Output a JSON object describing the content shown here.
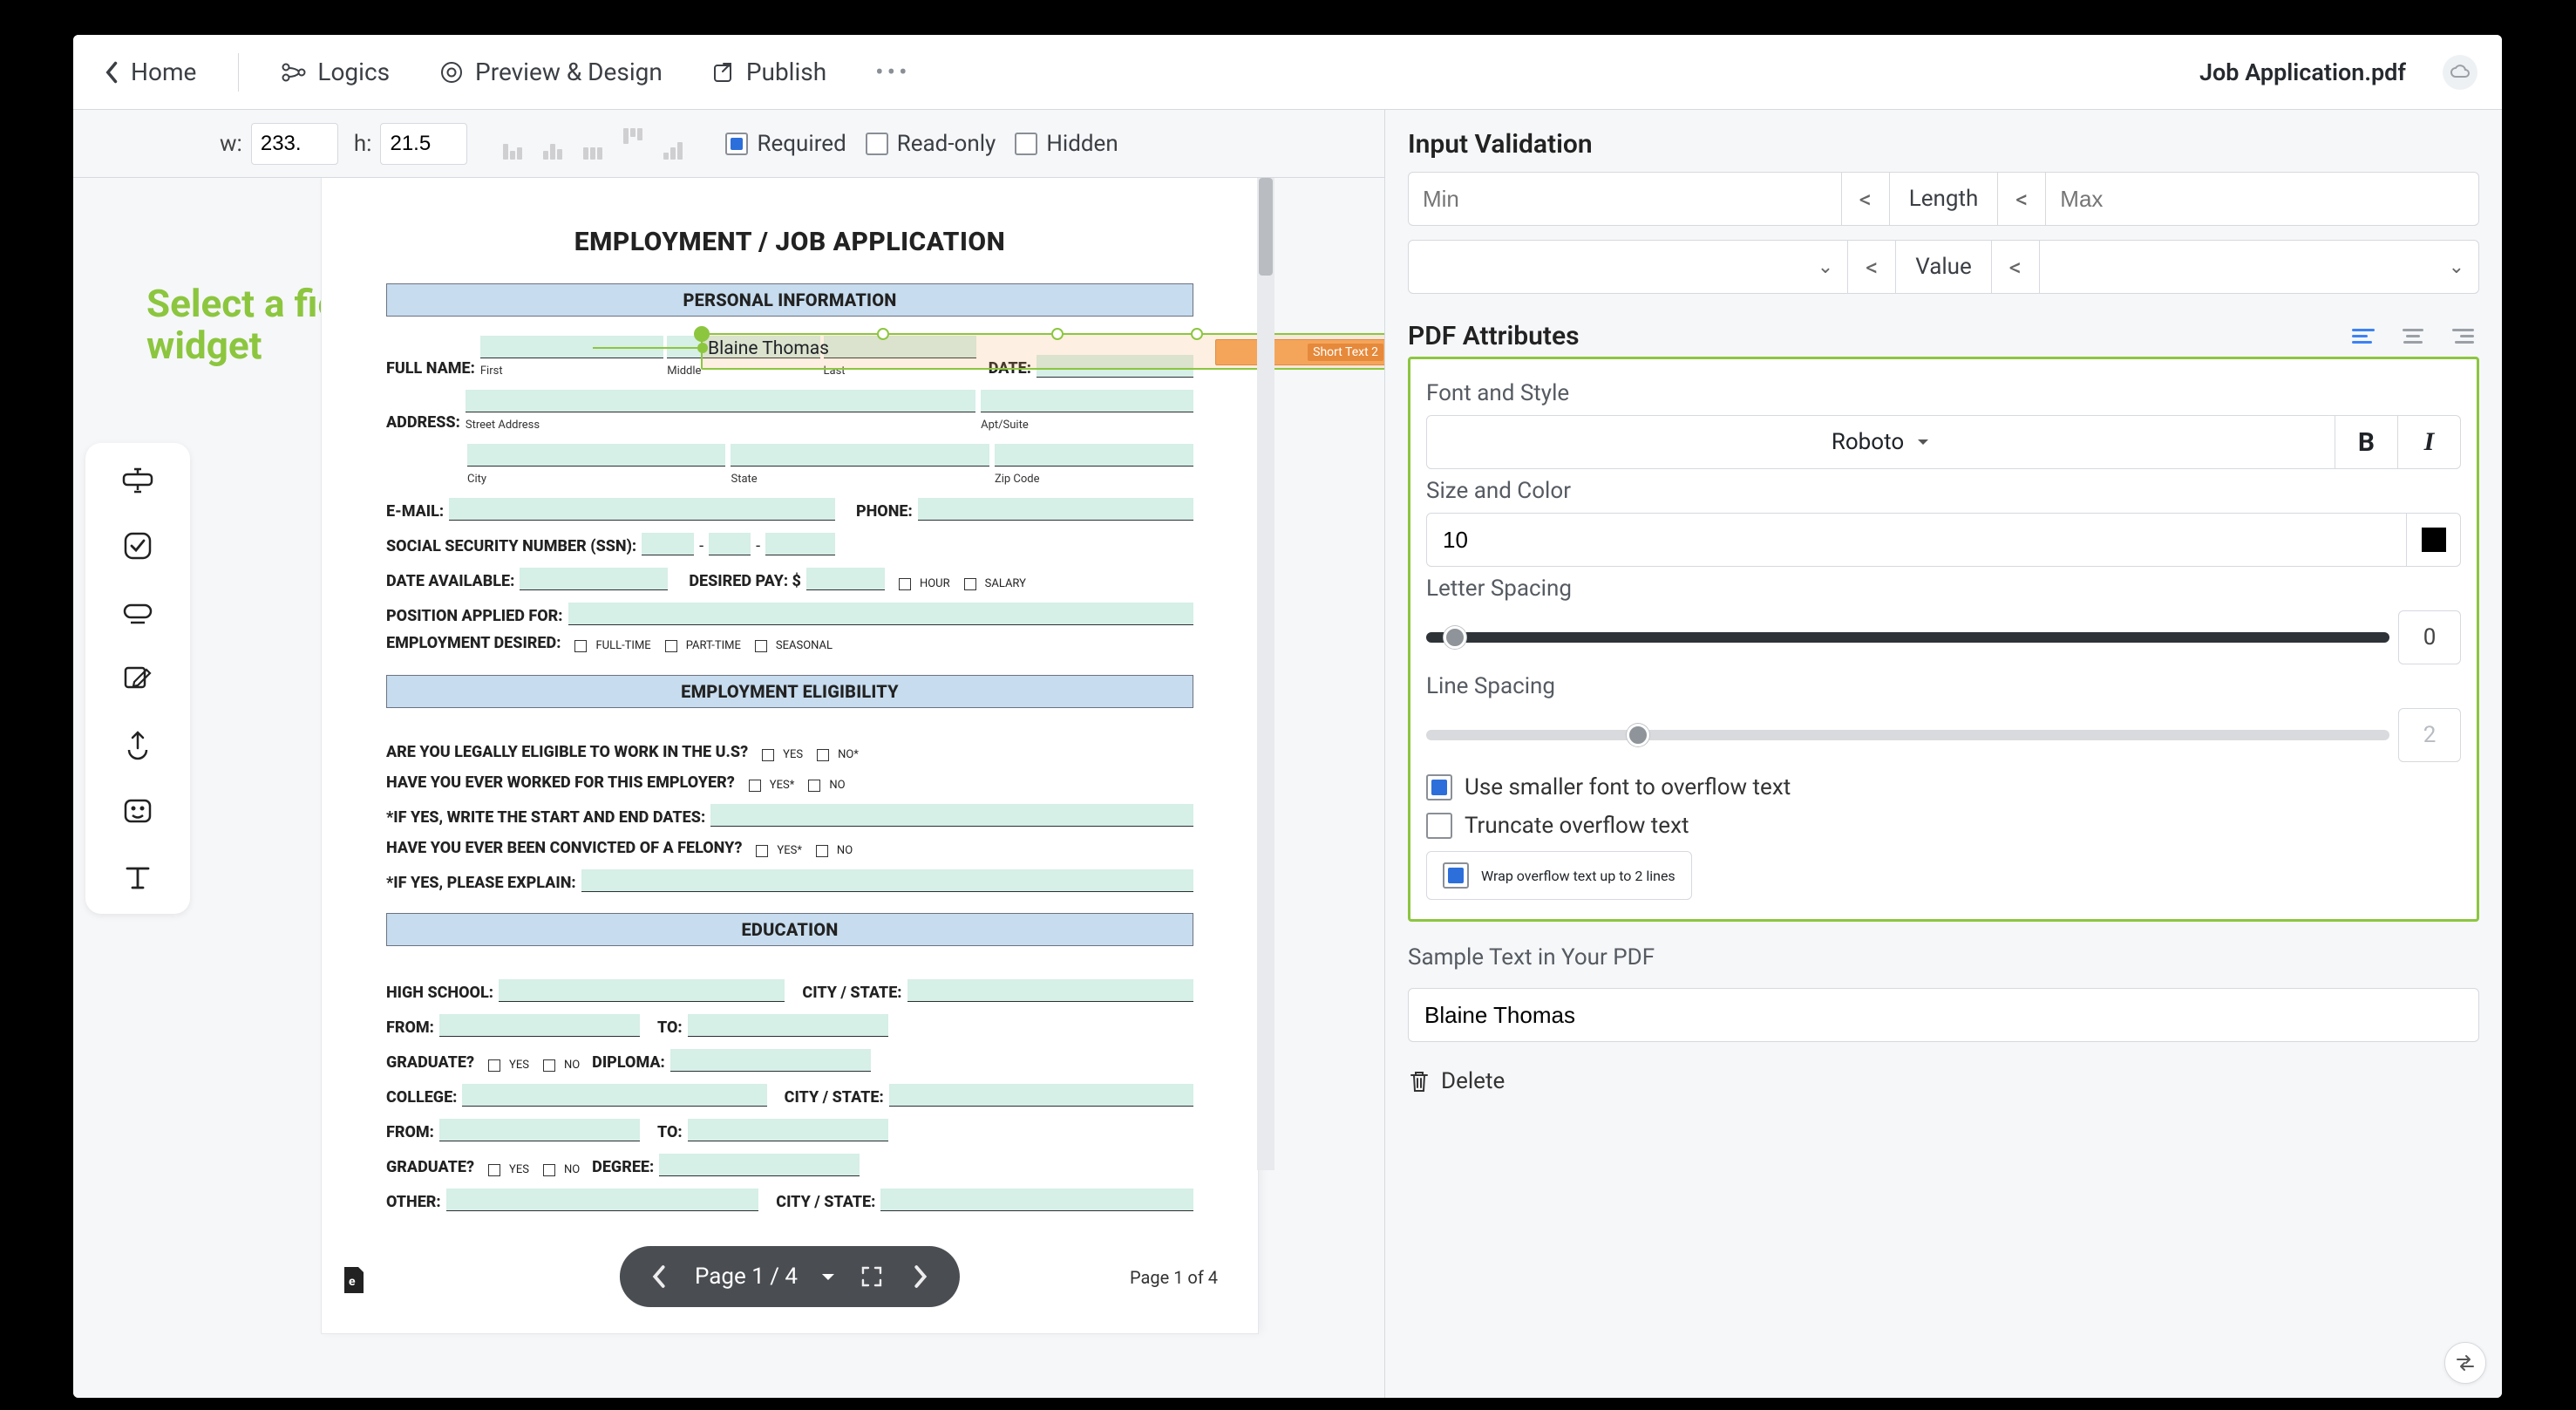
{
  "header": {
    "home": "Home",
    "logics": "Logics",
    "preview": "Preview & Design",
    "publish": "Publish",
    "filename": "Job Application.pdf"
  },
  "props": {
    "w_label": "w:",
    "w_value": "233.",
    "h_label": "h:",
    "h_value": "21.5",
    "required": "Required",
    "readonly": "Read-only",
    "hidden": "Hidden"
  },
  "canvas": {
    "prompt": "Select a field widget",
    "title": "EMPLOYMENT / JOB APPLICATION",
    "s_personal": "PERSONAL INFORMATION",
    "full_name": "FULL NAME:",
    "first": "First",
    "middle": "Middle",
    "last": "Last",
    "date": "DATE:",
    "short_text_tag": "Short Text 2",
    "selected_value": "Blaine Thomas",
    "address": "ADDRESS:",
    "street": "Street Address",
    "apt": "Apt/Suite",
    "city": "City",
    "state": "State",
    "zip": "Zip Code",
    "email": "E-MAIL:",
    "phone": "PHONE:",
    "ssn": "SOCIAL SECURITY NUMBER (SSN):",
    "date_avail": "DATE AVAILABLE:",
    "desired_pay": "DESIRED PAY: $",
    "hour": "HOUR",
    "salary": "SALARY",
    "position": "POSITION APPLIED FOR:",
    "emp_desired": "EMPLOYMENT DESIRED:",
    "full_time": "FULL-TIME",
    "part_time": "PART-TIME",
    "seasonal": "SEASONAL",
    "s_elig": "EMPLOYMENT ELIGIBILITY",
    "q_eligible": "ARE YOU LEGALLY ELIGIBLE TO WORK IN THE U.S?",
    "q_worked": "HAVE YOU EVER WORKED FOR THIS EMPLOYER?",
    "q_dates": "*IF YES, WRITE THE START AND END DATES:",
    "q_felony": "HAVE YOU EVER BEEN CONVICTED OF A FELONY?",
    "q_explain": "*IF YES, PLEASE EXPLAIN:",
    "yes": "YES",
    "no": "NO",
    "no_star": "NO*",
    "yes_star": "YES*",
    "s_edu": "EDUCATION",
    "hs": "HIGH SCHOOL:",
    "citystate": "CITY / STATE:",
    "from": "FROM:",
    "to": "TO:",
    "grad": "GRADUATE?",
    "diploma": "DIPLOMA:",
    "college": "COLLEGE:",
    "degree": "DEGREE:",
    "other": "OTHER:"
  },
  "pager": {
    "label": "Page 1 / 4",
    "page_of": "Page 1 of 4"
  },
  "right": {
    "validation_title": "Input Validation",
    "min_ph": "Min",
    "length": "Length",
    "max_ph": "Max",
    "value": "Value",
    "pdf_title": "PDF Attributes",
    "font_style": "Font and Style",
    "font_name": "Roboto",
    "size_color": "Size and Color",
    "size_value": "10",
    "letter_spacing": "Letter Spacing",
    "letter_val": "0",
    "line_spacing": "Line Spacing",
    "line_val": "2",
    "opt_smaller": "Use smaller font to overflow text",
    "opt_truncate": "Truncate overflow text",
    "opt_wrap": "Wrap overflow text up to 2 lines",
    "sample_title": "Sample Text in Your PDF",
    "sample_value": "Blaine Thomas",
    "delete": "Delete"
  }
}
